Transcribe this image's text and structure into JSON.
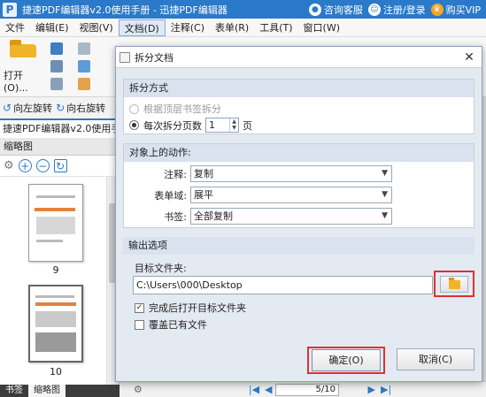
{
  "titlebar": {
    "app_logo": "P",
    "title": "捷速PDF编辑器v2.0使用手册 - 迅捷PDF编辑器",
    "service": "咨询客服",
    "account": "注册/登录",
    "vip": "购买VIP"
  },
  "menu": [
    "文件",
    "编辑(E)",
    "视图(V)",
    "文档(D)",
    "注释(C)",
    "表单(R)",
    "工具(T)",
    "窗口(W)"
  ],
  "ribbon": {
    "open_label": "打开(O)..."
  },
  "rotate": {
    "left": "向左旋转",
    "right": "向右旋转"
  },
  "doc_tab": "捷速PDF编辑器v2.0使用手",
  "thumb_panel": {
    "header": "缩略图",
    "pages": [
      {
        "num": "9"
      },
      {
        "num": "10"
      }
    ]
  },
  "bottom_tabs": [
    "书签",
    "缩略图"
  ],
  "status": {
    "page": "5/10"
  },
  "dialog": {
    "title": "拆分文档",
    "split_method": {
      "heading": "拆分方式",
      "opt_bookmark": "根据顶层书签拆分",
      "opt_pages_prefix": "每次拆分页数",
      "pages_value": "1",
      "pages_suffix": "页"
    },
    "actions": {
      "heading": "对象上的动作:",
      "annot_label": "注释:",
      "annot_value": "复制",
      "form_label": "表单域:",
      "form_value": "展平",
      "bookmark_label": "书签:",
      "bookmark_value": "全部复制"
    },
    "output": {
      "heading": "输出选项",
      "folder_label": "目标文件夹:",
      "folder_path": "C:\\Users\\000\\Desktop",
      "open_after": "完成后打开目标文件夹",
      "open_after_checked": true,
      "overwrite": "覆盖已有文件",
      "overwrite_checked": false
    },
    "ok": "确定(O)",
    "cancel": "取消(C)"
  },
  "colors": {
    "accent": "#2b79c9",
    "highlight": "#e03030"
  }
}
